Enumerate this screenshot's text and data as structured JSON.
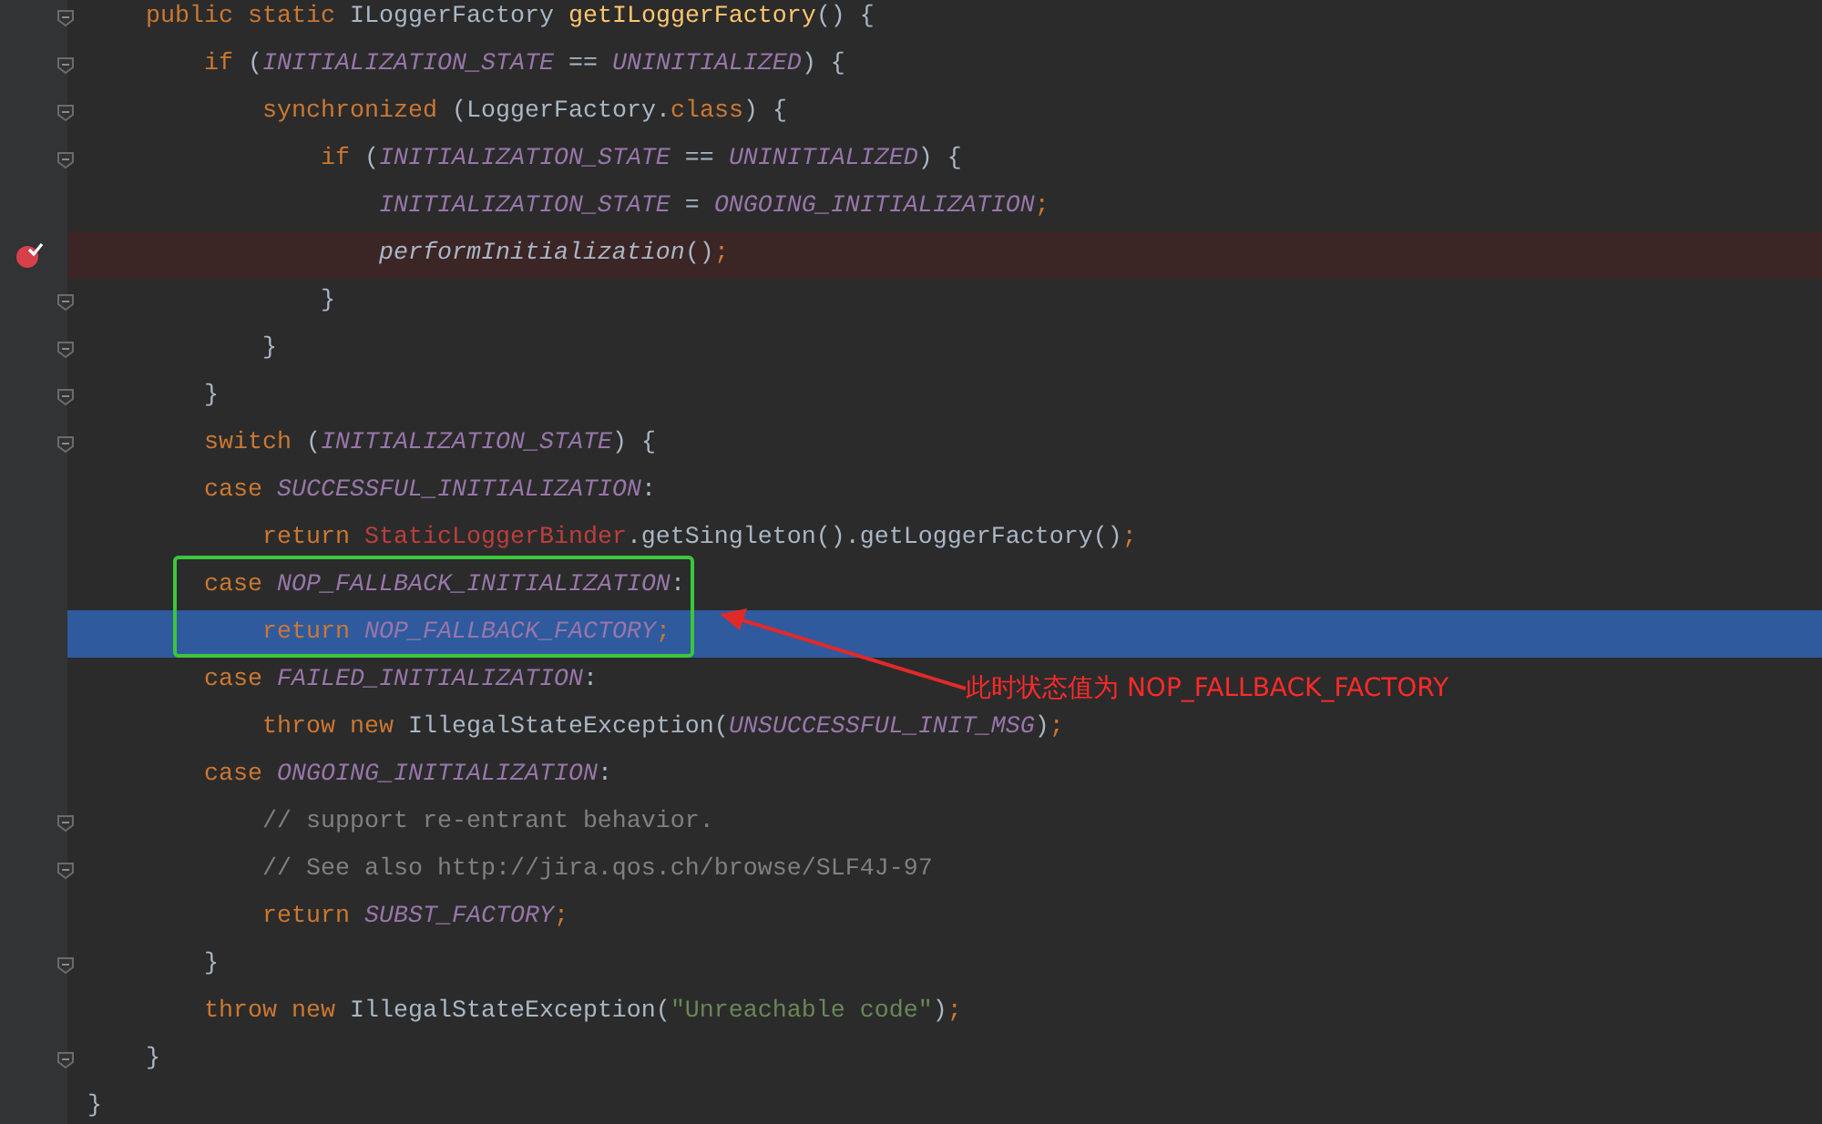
{
  "editor": {
    "lines": [
      {
        "fold_marker": true,
        "breakpoint": false,
        "execution_point": false,
        "tokens": [
          {
            "kind": "kw",
            "text": "    public static "
          },
          {
            "kind": "plain",
            "text": "ILoggerFactory "
          },
          {
            "kind": "decl",
            "text": "getILoggerFactory"
          },
          {
            "kind": "plain",
            "text": "() {"
          }
        ]
      },
      {
        "fold_marker": true,
        "breakpoint": false,
        "execution_point": false,
        "tokens": [
          {
            "kind": "kw",
            "text": "        if "
          },
          {
            "kind": "plain",
            "text": "("
          },
          {
            "kind": "const",
            "text": "INITIALIZATION_STATE"
          },
          {
            "kind": "plain",
            "text": " == "
          },
          {
            "kind": "const",
            "text": "UNINITIALIZED"
          },
          {
            "kind": "plain",
            "text": ") {"
          }
        ]
      },
      {
        "fold_marker": true,
        "breakpoint": false,
        "execution_point": false,
        "tokens": [
          {
            "kind": "kw",
            "text": "            synchronized "
          },
          {
            "kind": "plain",
            "text": "(LoggerFactory."
          },
          {
            "kind": "kw",
            "text": "class"
          },
          {
            "kind": "plain",
            "text": ") {"
          }
        ]
      },
      {
        "fold_marker": true,
        "breakpoint": false,
        "execution_point": false,
        "tokens": [
          {
            "kind": "kw",
            "text": "                if "
          },
          {
            "kind": "plain",
            "text": "("
          },
          {
            "kind": "const",
            "text": "INITIALIZATION_STATE"
          },
          {
            "kind": "plain",
            "text": " == "
          },
          {
            "kind": "const",
            "text": "UNINITIALIZED"
          },
          {
            "kind": "plain",
            "text": ") {"
          }
        ]
      },
      {
        "fold_marker": false,
        "breakpoint": false,
        "execution_point": false,
        "tokens": [
          {
            "kind": "const",
            "text": "                    INITIALIZATION_STATE"
          },
          {
            "kind": "plain",
            "text": " = "
          },
          {
            "kind": "const",
            "text": "ONGOING_INITIALIZATION"
          },
          {
            "kind": "kw",
            "text": ";"
          }
        ]
      },
      {
        "fold_marker": false,
        "breakpoint": true,
        "execution_point": false,
        "tokens": [
          {
            "kind": "call",
            "text": "                    performInitialization"
          },
          {
            "kind": "plain",
            "text": "()"
          },
          {
            "kind": "kw",
            "text": ";"
          }
        ]
      },
      {
        "fold_marker": true,
        "breakpoint": false,
        "execution_point": false,
        "tokens": [
          {
            "kind": "plain",
            "text": "                }"
          }
        ]
      },
      {
        "fold_marker": true,
        "breakpoint": false,
        "execution_point": false,
        "tokens": [
          {
            "kind": "plain",
            "text": "            }"
          }
        ]
      },
      {
        "fold_marker": true,
        "breakpoint": false,
        "execution_point": false,
        "tokens": [
          {
            "kind": "plain",
            "text": "        }"
          }
        ]
      },
      {
        "fold_marker": true,
        "breakpoint": false,
        "execution_point": false,
        "tokens": [
          {
            "kind": "kw",
            "text": "        switch "
          },
          {
            "kind": "plain",
            "text": "("
          },
          {
            "kind": "const",
            "text": "INITIALIZATION_STATE"
          },
          {
            "kind": "plain",
            "text": ") {"
          }
        ]
      },
      {
        "fold_marker": false,
        "breakpoint": false,
        "execution_point": false,
        "tokens": [
          {
            "kind": "kw",
            "text": "        case "
          },
          {
            "kind": "const",
            "text": "SUCCESSFUL_INITIALIZATION"
          },
          {
            "kind": "plain",
            "text": ":"
          }
        ]
      },
      {
        "fold_marker": false,
        "breakpoint": false,
        "execution_point": false,
        "tokens": [
          {
            "kind": "kw",
            "text": "            return "
          },
          {
            "kind": "err",
            "text": "StaticLoggerBinder"
          },
          {
            "kind": "plain",
            "text": ".getSingleton().getLoggerFactory()"
          },
          {
            "kind": "kw",
            "text": ";"
          }
        ]
      },
      {
        "fold_marker": false,
        "breakpoint": false,
        "execution_point": false,
        "tokens": [
          {
            "kind": "kw",
            "text": "        case "
          },
          {
            "kind": "const",
            "text": "NOP_FALLBACK_INITIALIZATION"
          },
          {
            "kind": "plain",
            "text": ":"
          }
        ]
      },
      {
        "fold_marker": false,
        "breakpoint": false,
        "execution_point": true,
        "tokens": [
          {
            "kind": "kw",
            "text": "            return "
          },
          {
            "kind": "const",
            "text": "NOP_FALLBACK_FACTORY"
          },
          {
            "kind": "kw",
            "text": ";"
          }
        ]
      },
      {
        "fold_marker": false,
        "breakpoint": false,
        "execution_point": false,
        "tokens": [
          {
            "kind": "kw",
            "text": "        case "
          },
          {
            "kind": "const",
            "text": "FAILED_INITIALIZATION"
          },
          {
            "kind": "plain",
            "text": ":"
          }
        ]
      },
      {
        "fold_marker": false,
        "breakpoint": false,
        "execution_point": false,
        "tokens": [
          {
            "kind": "kw",
            "text": "            throw new "
          },
          {
            "kind": "plain",
            "text": "IllegalStateException("
          },
          {
            "kind": "const",
            "text": "UNSUCCESSFUL_INIT_MSG"
          },
          {
            "kind": "plain",
            "text": ")"
          },
          {
            "kind": "kw",
            "text": ";"
          }
        ]
      },
      {
        "fold_marker": false,
        "breakpoint": false,
        "execution_point": false,
        "tokens": [
          {
            "kind": "kw",
            "text": "        case "
          },
          {
            "kind": "const",
            "text": "ONGOING_INITIALIZATION"
          },
          {
            "kind": "plain",
            "text": ":"
          }
        ]
      },
      {
        "fold_marker": true,
        "breakpoint": false,
        "execution_point": false,
        "tokens": [
          {
            "kind": "comment",
            "text": "            // support re-entrant behavior."
          }
        ]
      },
      {
        "fold_marker": true,
        "breakpoint": false,
        "execution_point": false,
        "tokens": [
          {
            "kind": "comment",
            "text": "            // See also http://jira.qos.ch/browse/SLF4J-97"
          }
        ]
      },
      {
        "fold_marker": false,
        "breakpoint": false,
        "execution_point": false,
        "tokens": [
          {
            "kind": "kw",
            "text": "            return "
          },
          {
            "kind": "const",
            "text": "SUBST_FACTORY"
          },
          {
            "kind": "kw",
            "text": ";"
          }
        ]
      },
      {
        "fold_marker": true,
        "breakpoint": false,
        "execution_point": false,
        "tokens": [
          {
            "kind": "plain",
            "text": "        }"
          }
        ]
      },
      {
        "fold_marker": false,
        "breakpoint": false,
        "execution_point": false,
        "tokens": [
          {
            "kind": "kw",
            "text": "        throw new "
          },
          {
            "kind": "plain",
            "text": "IllegalStateException("
          },
          {
            "kind": "str",
            "text": "\"Unreachable code\""
          },
          {
            "kind": "plain",
            "text": ")"
          },
          {
            "kind": "kw",
            "text": ";"
          }
        ]
      },
      {
        "fold_marker": true,
        "breakpoint": false,
        "execution_point": false,
        "tokens": [
          {
            "kind": "plain",
            "text": "    }"
          }
        ]
      },
      {
        "fold_marker": false,
        "breakpoint": false,
        "execution_point": false,
        "tokens": [
          {
            "kind": "plain",
            "text": "}"
          }
        ]
      }
    ]
  },
  "annotation": {
    "label": "此时状态值为 NOP_FALLBACK_FACTORY"
  }
}
